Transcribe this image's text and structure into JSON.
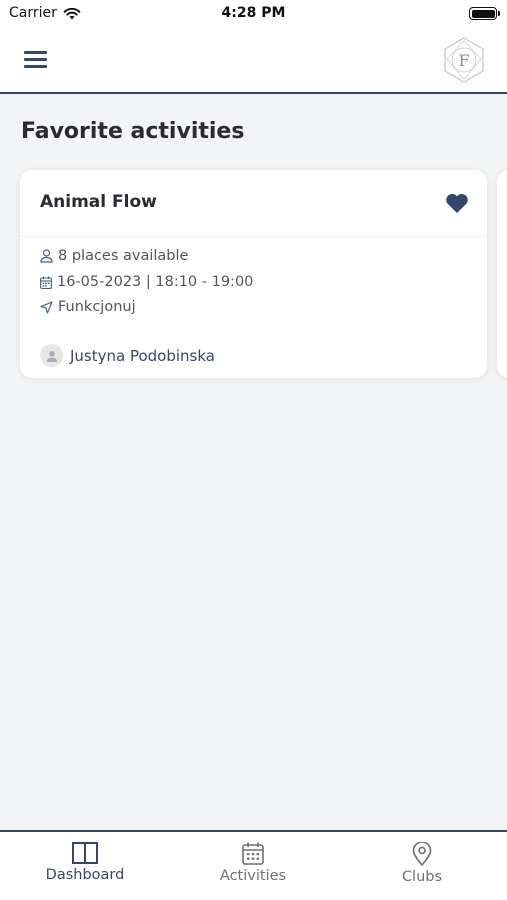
{
  "status_bar": {
    "carrier": "Carrier",
    "time": "4:28 PM"
  },
  "header": {
    "logo_letter": "F"
  },
  "page": {
    "title": "Favorite activities"
  },
  "activity_card": {
    "title": "Animal Flow",
    "favorite": true,
    "places": "8 places available",
    "datetime": "16-05-2023 | 18:10 - 19:00",
    "club": "Funkcjonuj",
    "instructor": "Justyna Podobinska"
  },
  "tab_bar": {
    "tabs": [
      {
        "label": "Dashboard",
        "icon": "dashboard-icon",
        "active": true
      },
      {
        "label": "Activities",
        "icon": "calendar-icon",
        "active": false
      },
      {
        "label": "Clubs",
        "icon": "location-pin-icon",
        "active": false
      }
    ]
  },
  "colors": {
    "accent": "#33476d",
    "background": "#f3f4f5",
    "card": "#ffffff",
    "muted_text": "#55555c"
  }
}
